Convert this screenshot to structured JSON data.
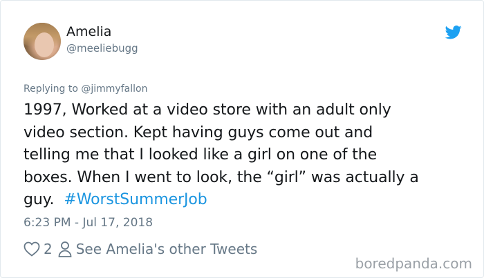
{
  "user": {
    "name": "Amelia",
    "handle": "@meeliebugg"
  },
  "tweet": {
    "replying_to": "Replying to @jimmyfallon",
    "lines": [
      "1997, Worked at a video store with an adult only",
      "video section. Kept having guys come out and",
      "telling me that I looked like a girl on one of the",
      "boxes. When I went to look, the “girl” was actually a",
      "guy."
    ],
    "hashtag": "#WorstSummerJob",
    "timestamp": "6:23 PM - Jul 17, 2018"
  },
  "actions": {
    "like_count": "2",
    "profile_link": "See Amelia's other Tweets"
  },
  "watermark": "boredpanda.com",
  "colors": {
    "text": "#14171a",
    "secondary": "#657786",
    "link": "#1b95e0",
    "twitter_blue": "#1da1f2"
  },
  "icons": {
    "brand": "twitter-bird-icon",
    "like": "heart-icon",
    "profile": "person-icon"
  }
}
